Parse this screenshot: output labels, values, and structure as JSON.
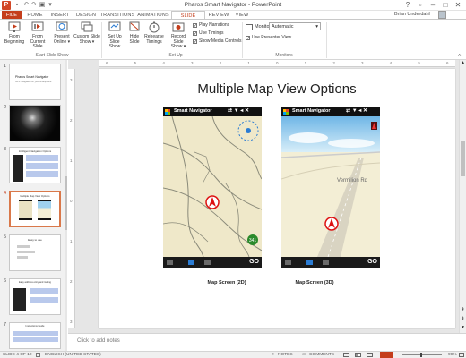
{
  "window": {
    "title": "Pharos Smart Navigator - PowerPoint",
    "user": "Brian Underdahl",
    "minimize": "–",
    "restore": "□",
    "close": "✕",
    "help": "?"
  },
  "tabs": [
    "FILE",
    "HOME",
    "INSERT",
    "DESIGN",
    "TRANSITIONS",
    "ANIMATIONS",
    "SLIDE SHOW",
    "REVIEW",
    "VIEW"
  ],
  "active_tab": "SLIDE SHOW",
  "ribbon": {
    "start_group": {
      "label": "Start Slide Show",
      "from_beginning": [
        "From",
        "Beginning"
      ],
      "from_current": [
        "From",
        "Current Slide"
      ],
      "present_online": [
        "Present",
        "Online ▾"
      ],
      "custom_show": [
        "Custom Slide",
        "Show ▾"
      ]
    },
    "setup_group": {
      "label": "Set Up",
      "set_up_show": [
        "Set Up",
        "Slide Show"
      ],
      "hide_slide": [
        "Hide",
        "Slide"
      ],
      "rehearse": [
        "Rehearse",
        "Timings"
      ],
      "record": [
        "Record Slide",
        "Show ▾"
      ],
      "play_narrations": "Play Narrations",
      "use_timings": "Use Timings",
      "show_media_controls": "Show Media Controls"
    },
    "monitors_group": {
      "label": "Monitors",
      "monitor_label": "Monitor:",
      "monitor_value": "Automatic",
      "presenter_view": "Use Presenter View"
    }
  },
  "ruler": {
    "h_ticks": [
      "6",
      "5",
      "4",
      "3",
      "2",
      "1",
      "0",
      "1",
      "2",
      "3",
      "4",
      "5",
      "6"
    ],
    "v_ticks": [
      "3",
      "2",
      "1",
      "0",
      "1",
      "2",
      "3"
    ]
  },
  "thumbnails": [
    {
      "num": "1",
      "title": "Pharos Smart Navigator",
      "subtitle": "GPS navigation for your smartphone"
    },
    {
      "num": "2",
      "title": "",
      "subtitle": ""
    },
    {
      "num": "3",
      "title": "Intelligent Navigation Options",
      "subtitle": ""
    },
    {
      "num": "4",
      "title": "Multiple Map View Options",
      "subtitle": ""
    },
    {
      "num": "5",
      "title": "Easy to use",
      "subtitle": ""
    },
    {
      "num": "6",
      "title": "Easy address entry and routing",
      "subtitle": ""
    },
    {
      "num": "7",
      "title": "Instructions Guide",
      "subtitle": ""
    }
  ],
  "slide": {
    "title": "Multiple Map View Options",
    "phone_app_name": "Smart Navigator",
    "go_label": "GO",
    "street_label": "Vermilion Rd",
    "route_badge": "341",
    "captions": [
      "Map Screen (2D)",
      "Map Screen (3D)"
    ]
  },
  "notes_placeholder": "Click to add notes",
  "status": {
    "slide": "SLIDE 4 OF 12",
    "language": "ENGLISH (UNITED STATES)",
    "notes": "NOTES",
    "comments": "COMMENTS",
    "zoom": "99%"
  },
  "colors": {
    "accent": "#c43e1c",
    "map2d_bg": "#efe8c9",
    "sky": "#9fd1ee",
    "ground3d": "#f3eed5"
  }
}
